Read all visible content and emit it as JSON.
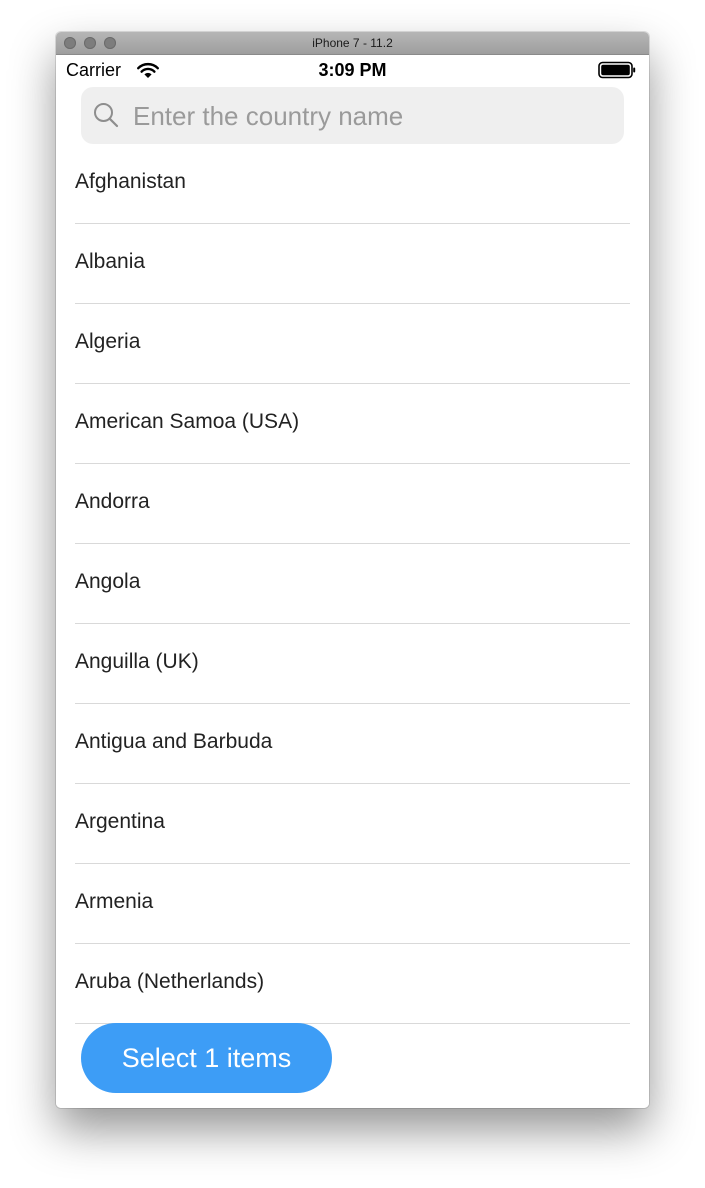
{
  "window": {
    "title": "iPhone 7 - 11.2"
  },
  "status_bar": {
    "carrier": "Carrier",
    "time": "3:09 PM",
    "icons": [
      "wifi-icon",
      "battery-icon"
    ]
  },
  "search": {
    "icon": "search-icon",
    "placeholder": "Enter the country name",
    "value": ""
  },
  "countries": [
    "Afghanistan",
    "Albania",
    "Algeria",
    "American Samoa (USA)",
    "Andorra",
    "Angola",
    "Anguilla (UK)",
    "Antigua and Barbuda",
    "Argentina",
    "Armenia",
    "Aruba (Netherlands)"
  ],
  "action": {
    "select_label": "Select 1 items"
  },
  "colors": {
    "accent": "#3d9df6",
    "search_background": "#efefef",
    "divider": "#d9d9d9"
  }
}
